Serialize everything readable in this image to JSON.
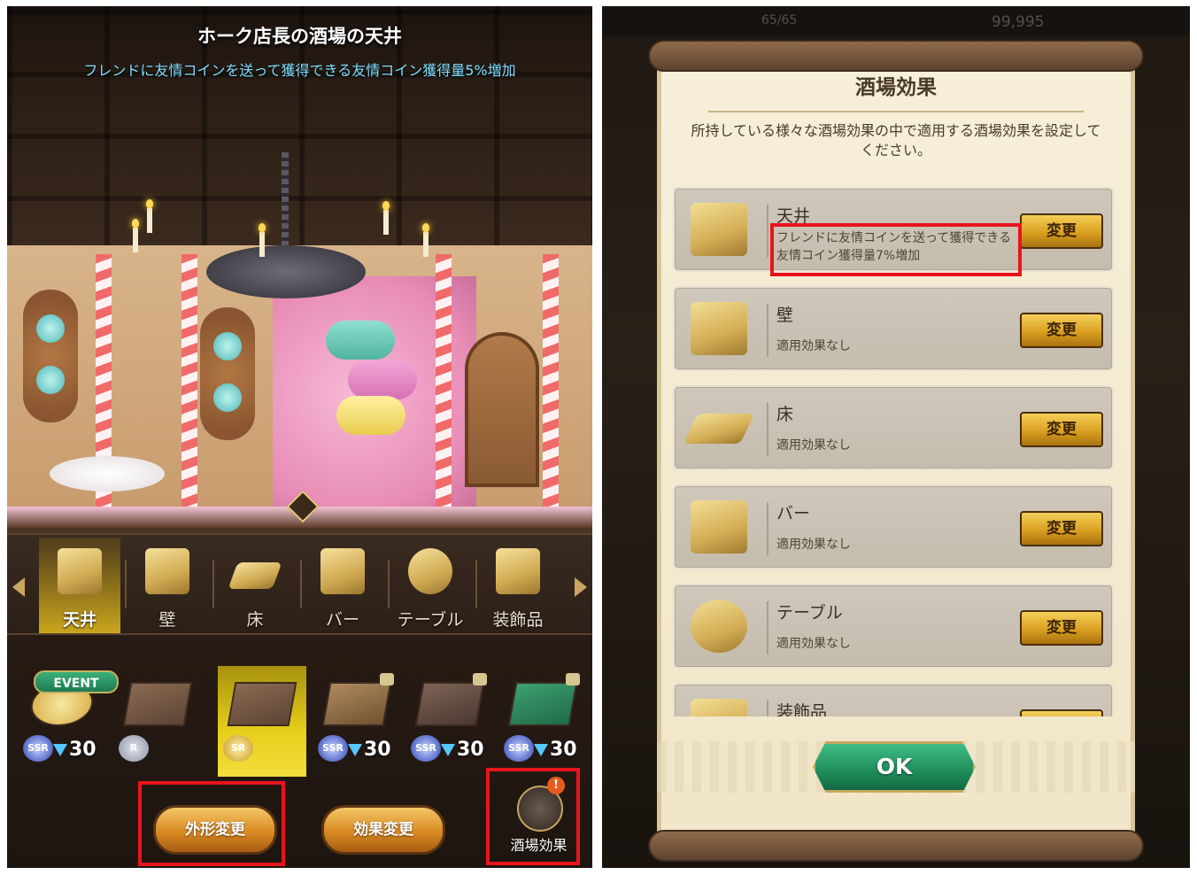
{
  "left": {
    "title": "ホーク店長の酒場の天井",
    "subtitle": "フレンドに友情コインを送って獲得できる友情コイン獲得量5%増加",
    "categories": [
      {
        "label": "天井",
        "icon": "ceiling-icon",
        "selected": true
      },
      {
        "label": "壁",
        "icon": "wall-icon",
        "selected": false
      },
      {
        "label": "床",
        "icon": "floor-icon",
        "selected": false
      },
      {
        "label": "バー",
        "icon": "bar-icon",
        "selected": false
      },
      {
        "label": "テーブル",
        "icon": "table-icon",
        "selected": false
      },
      {
        "label": "装飾品",
        "icon": "decoration-icon",
        "selected": false
      }
    ],
    "items": [
      {
        "rarity": "SSR",
        "cost": "30",
        "tag": "EVENT",
        "locked": false
      },
      {
        "rarity": "R",
        "cost": "",
        "locked": false
      },
      {
        "rarity": "SR",
        "cost": "",
        "locked": false,
        "selected": true
      },
      {
        "rarity": "SSR",
        "cost": "30",
        "locked": true
      },
      {
        "rarity": "SSR",
        "cost": "30",
        "locked": true
      },
      {
        "rarity": "SSR",
        "cost": "30",
        "locked": true
      }
    ],
    "buttons": {
      "appearance": "外形変更",
      "effect": "効果変更",
      "tavern_effect": "酒場効果",
      "alert": "!"
    }
  },
  "right": {
    "topbar": {
      "stamina": "65/65",
      "gems": "99,995"
    },
    "title": "酒場効果",
    "description": "所持している様々な酒場効果の中で適用する酒場効果を設定してください。",
    "rows": [
      {
        "name": "天井",
        "effect": "フレンドに友情コインを送って獲得できる友情コイン獲得量7%増加",
        "button": "変更"
      },
      {
        "name": "壁",
        "effect": "適用効果なし",
        "button": "変更"
      },
      {
        "name": "床",
        "effect": "適用効果なし",
        "button": "変更"
      },
      {
        "name": "バー",
        "effect": "適用効果なし",
        "button": "変更"
      },
      {
        "name": "テーブル",
        "effect": "適用効果なし",
        "button": "変更"
      },
      {
        "name": "装飾品",
        "effect": "",
        "button": "変更"
      }
    ],
    "ok": "OK"
  },
  "colors": {
    "highlight": "#e8141c",
    "ok_green": "#1f8c5a",
    "gold": "#d9a021",
    "subtitle_cyan": "#7fe0ff"
  }
}
